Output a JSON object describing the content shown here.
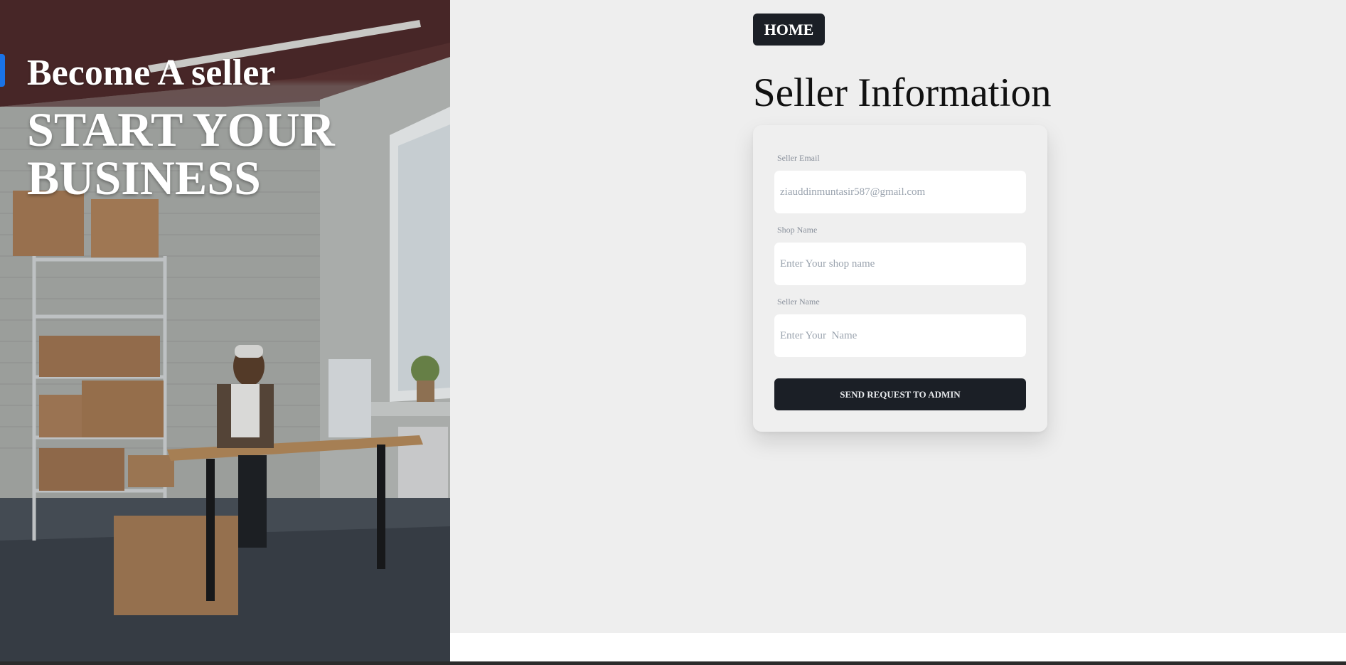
{
  "hero": {
    "subtitle": "Become A seller",
    "title": "START YOUR BUSINESS",
    "image_description_icon": "warehouse-office-photo",
    "accent_color": "#1a73e8"
  },
  "nav": {
    "home_label": "HOME"
  },
  "form": {
    "title": "Seller Information",
    "fields": [
      {
        "label": "Seller Email",
        "value": "ziauddinmuntasir587@gmail.com",
        "placeholder": ""
      },
      {
        "label": "Shop Name",
        "value": "",
        "placeholder": "Enter Your shop name"
      },
      {
        "label": "Seller Name",
        "value": "",
        "placeholder": "Enter Your  Name"
      }
    ],
    "submit_label": "SEND REQUEST TO ADMIN"
  },
  "colors": {
    "dark_button": "#1b1f26",
    "panel_bg": "#eeeeee"
  }
}
